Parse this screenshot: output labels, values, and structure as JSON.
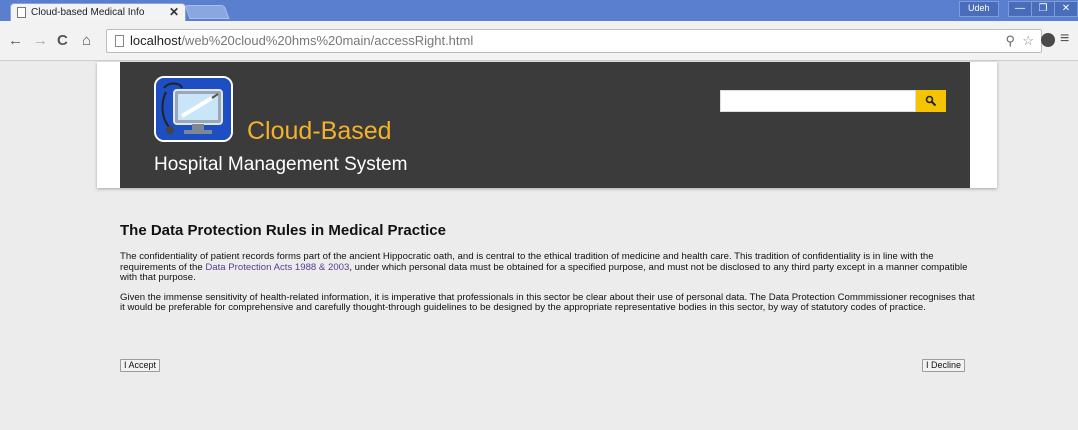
{
  "browser": {
    "tab_title": "Cloud-based Medical Info",
    "tab_close": "✕",
    "user_label": "Udeh",
    "window_controls": {
      "minimize": "—",
      "maximize": "❐",
      "close": "✕"
    },
    "url_prefix": "localhost",
    "url_path": "/web%20cloud%20hms%20main/accessRight.html",
    "icons": [
      "back-arrow-icon",
      "forward-arrow-icon",
      "reload-icon",
      "home-icon",
      "page-icon",
      "zoom-icon",
      "star-icon",
      "extension-icon",
      "menu-icon"
    ]
  },
  "header": {
    "brand_title": "Cloud-Based",
    "brand_subtitle": "Hospital Management System",
    "search_placeholder": "",
    "colors": {
      "banner": "#3b3b3b",
      "title": "#f4b22b",
      "search_button": "#f4c400",
      "logo_bg": "#1e4fc2"
    }
  },
  "article": {
    "heading": "The Data Protection Rules in Medical Practice",
    "p1_before": "The confidentiality of patient records forms part of the ancient Hippocratic oath, and is central to the ethical tradition of medicine and health care. This tradition of confidentiality is in line with the requirements of the ",
    "p1_link": "Data Protection Acts 1988 & 2003",
    "p1_after": ", under which personal data must be obtained for a specified purpose, and must not be disclosed to any third party except in a manner compatible with that purpose.",
    "p2": "Given the immense sensitivity of health-related information, it is imperative that professionals in this sector be clear about their use of personal data. The Data Protection Commmissioner recognises that it would be preferable for comprehensive and carefully thought-through guidelines to be designed by the appropriate representative bodies in this sector, by way of statutory codes of practice."
  },
  "actions": {
    "accept_label": "I Accept",
    "decline_label": "I Decline"
  }
}
